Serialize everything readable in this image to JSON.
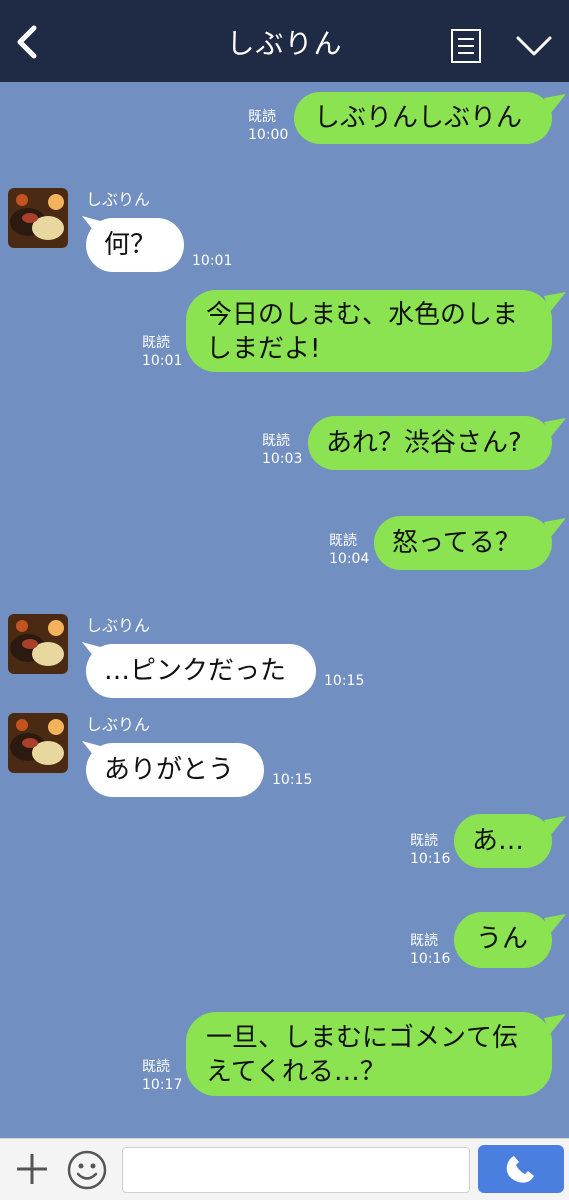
{
  "header": {
    "title": "しぶりん",
    "icons": [
      "back-arrow-icon",
      "menu-icon",
      "chevron-down-icon"
    ]
  },
  "messages": [
    {
      "dir": "out",
      "text": "しぶりんしぶりん",
      "read": "既読",
      "time": "10:00"
    },
    {
      "dir": "in",
      "sender": "しぶりん",
      "text": "何？",
      "time": "10:01"
    },
    {
      "dir": "out",
      "text": "今日のしまむ、水色のしましまだよ!",
      "read": "既読",
      "time": "10:01"
    },
    {
      "dir": "out",
      "text": "あれ？渋谷さん?",
      "read": "既読",
      "time": "10:03"
    },
    {
      "dir": "out",
      "text": "怒ってる？",
      "read": "既読",
      "time": "10:04"
    },
    {
      "dir": "in",
      "sender": "しぶりん",
      "text": "…ピンクだった",
      "time": "10:15"
    },
    {
      "dir": "in",
      "sender": "しぶりん",
      "text": "ありがとう",
      "time": "10:15"
    },
    {
      "dir": "out",
      "text": "あ…",
      "read": "既読",
      "time": "10:16"
    },
    {
      "dir": "out",
      "text": "うん",
      "read": "既読",
      "time": "10:16"
    },
    {
      "dir": "out",
      "text": "一旦、しまむにゴメンて伝えてくれる…？",
      "read": "既読",
      "time": "10:17"
    }
  ],
  "composer": {
    "placeholder": "",
    "icons": [
      "plus-icon",
      "smiley-icon",
      "phone-icon"
    ]
  },
  "colors": {
    "background": "#7190c1",
    "header": "#1f2a44",
    "outgoing_bubble": "#8be351",
    "incoming_bubble": "#ffffff",
    "call_button": "#4a7fe0"
  }
}
